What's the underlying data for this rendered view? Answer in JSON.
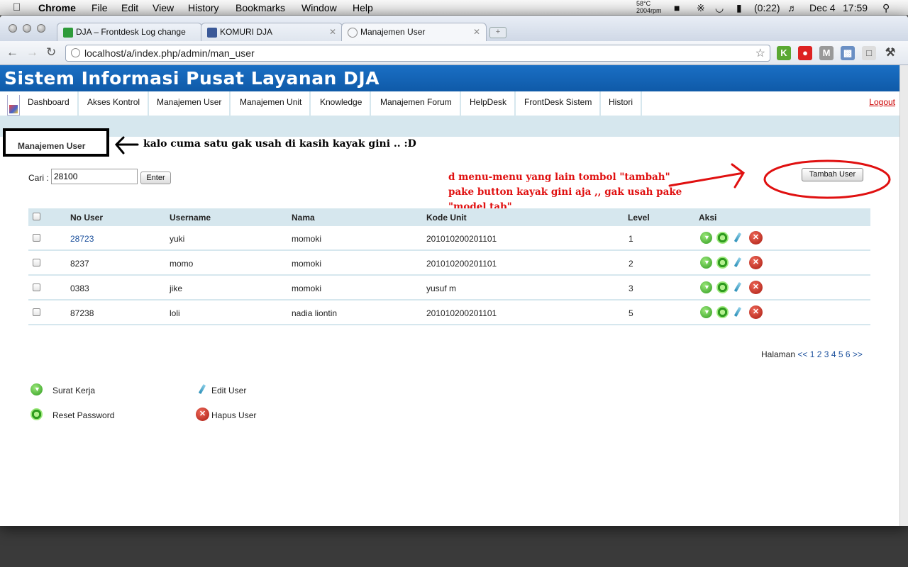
{
  "menubar": {
    "app": "Chrome",
    "items": [
      "File",
      "Edit",
      "View",
      "History",
      "Bookmarks",
      "Window",
      "Help"
    ],
    "temp": "58°C",
    "rpm": "2004rpm",
    "battery": "(0:22)",
    "date": "Dec 4",
    "time": "17:59"
  },
  "tabs": [
    {
      "title": "DJA – Frontdesk Log change",
      "icon_color": "#2e9b3a"
    },
    {
      "title": "KOMURI DJA",
      "icon_color": "#3b5998"
    },
    {
      "title": "Manajemen User",
      "icon_color": "#888888"
    }
  ],
  "toolbar": {
    "url": "localhost/a/index.php/admin/man_user"
  },
  "site": {
    "title": "Sistem Informasi Pusat Layanan DJA",
    "nav": [
      "Dashboard",
      "Akses Kontrol",
      "Manajemen User",
      "Manajemen Unit",
      "Knowledge",
      "Manajemen Forum",
      "HelpDesk",
      "FrontDesk Sistem",
      "Histori"
    ],
    "logout": "Logout",
    "subtab": "Manajemen User"
  },
  "annotations": {
    "black": "kalo cuma satu gak usah di kasih kayak gini .. :D",
    "red": "d menu-menu yang lain tombol \"tambah\" pake button kayak gini aja ,, gak usah pake \"model tab\""
  },
  "search": {
    "label": "Cari :",
    "value": "28100",
    "button": "Enter"
  },
  "add_button": "Tambah User",
  "table": {
    "headers": [
      "No User",
      "Username",
      "Nama",
      "Kode Unit",
      "Level",
      "Aksi"
    ],
    "rows": [
      {
        "no": "28723",
        "username": "yuki",
        "nama": "momoki",
        "kode": "201010200201101",
        "level": "1"
      },
      {
        "no": "8237",
        "username": "momo",
        "nama": "momoki",
        "kode": "201010200201101",
        "level": "2"
      },
      {
        "no": "0383",
        "username": "jike",
        "nama": "momoki",
        "kode": "yusuf m",
        "level": "3"
      },
      {
        "no": "87238",
        "username": "loli",
        "nama": "nadia liontin",
        "kode": "201010200201101",
        "level": "5"
      }
    ]
  },
  "pager": {
    "label": "Halaman",
    "prev": "<<",
    "pages": [
      "1",
      "2",
      "3",
      "4",
      "5",
      "6"
    ],
    "next": ">>"
  },
  "legend": {
    "surat": "Surat Kerja",
    "reset": "Reset Password",
    "edit": "Edit User",
    "hapus": "Hapus User"
  }
}
